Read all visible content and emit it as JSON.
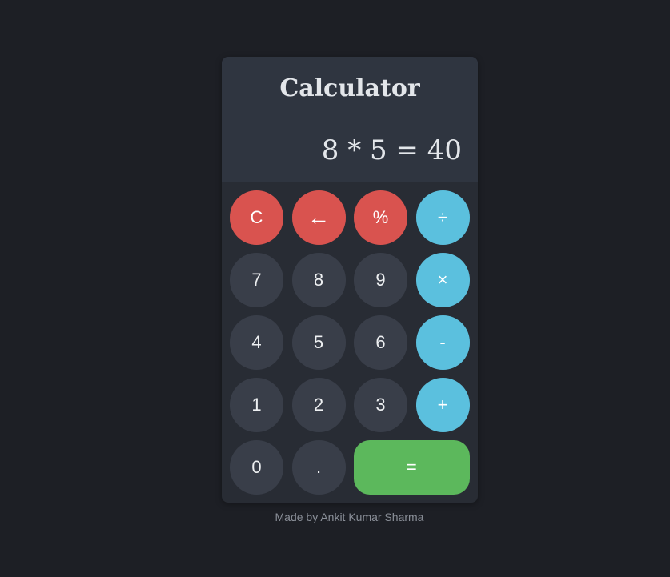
{
  "calculator": {
    "title": "Calculator",
    "display": "8 * 5 = 40",
    "keys": [
      {
        "label": "C",
        "type": "fn",
        "name": "clear-button"
      },
      {
        "label": "←",
        "type": "fn",
        "name": "backspace-button"
      },
      {
        "label": "%",
        "type": "fn",
        "name": "percent-button"
      },
      {
        "label": "÷",
        "type": "op",
        "name": "divide-button"
      },
      {
        "label": "7",
        "type": "num",
        "name": "digit-7-button"
      },
      {
        "label": "8",
        "type": "num",
        "name": "digit-8-button"
      },
      {
        "label": "9",
        "type": "num",
        "name": "digit-9-button"
      },
      {
        "label": "×",
        "type": "op",
        "name": "multiply-button"
      },
      {
        "label": "4",
        "type": "num",
        "name": "digit-4-button"
      },
      {
        "label": "5",
        "type": "num",
        "name": "digit-5-button"
      },
      {
        "label": "6",
        "type": "num",
        "name": "digit-6-button"
      },
      {
        "label": "-",
        "type": "op",
        "name": "subtract-button"
      },
      {
        "label": "1",
        "type": "num",
        "name": "digit-1-button"
      },
      {
        "label": "2",
        "type": "num",
        "name": "digit-2-button"
      },
      {
        "label": "3",
        "type": "num",
        "name": "digit-3-button"
      },
      {
        "label": "+",
        "type": "op",
        "name": "add-button"
      },
      {
        "label": "0",
        "type": "num",
        "name": "digit-0-button"
      },
      {
        "label": ".",
        "type": "num",
        "name": "decimal-button"
      },
      {
        "label": "=",
        "type": "eq",
        "name": "equals-button"
      }
    ]
  },
  "footer": {
    "credit": "Made by Ankit Kumar Sharma"
  },
  "colors": {
    "background": "#1d1f25",
    "panel": "#282c34",
    "function_key": "#d9534f",
    "operator_key": "#5bc0de",
    "equals_key": "#5cb85c",
    "number_key": "#393e49"
  }
}
